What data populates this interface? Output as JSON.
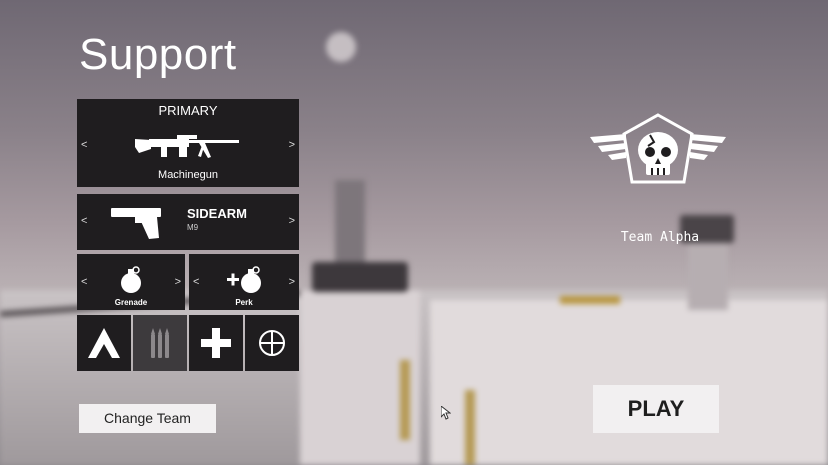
{
  "loadout": {
    "class_title": "Support",
    "primary": {
      "label": "PRIMARY",
      "weapon": "Machinegun",
      "prev": "<",
      "next": ">"
    },
    "sidearm": {
      "label": "SIDEARM",
      "weapon": "M9",
      "prev": "<",
      "next": ">"
    },
    "grenade": {
      "label": "Grenade",
      "prev": "<",
      "next": ">"
    },
    "perk": {
      "label": "Perk",
      "prev": "<",
      "next": ">"
    },
    "class_tiles": [
      {
        "icon": "chevron-up-icon"
      },
      {
        "icon": "ammo-icon",
        "selected": true
      },
      {
        "icon": "medic-cross-icon"
      },
      {
        "icon": "crosshair-icon"
      }
    ]
  },
  "team": {
    "name": "Team Alpha",
    "emblem": "skull-wings-icon"
  },
  "buttons": {
    "change_team": "Change Team",
    "play": "PLAY"
  },
  "colors": {
    "panel": "#1f1d1f",
    "panel_selected": "#3d3a3d",
    "button_bg": "#f2f0f1",
    "text": "#ffffff"
  }
}
